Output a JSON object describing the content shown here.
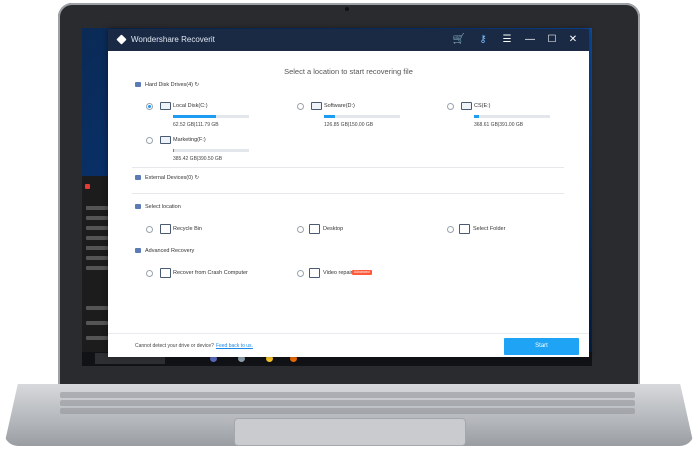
{
  "app": {
    "title": "Wondershare Recoverit",
    "heading": "Select a location to start recovering file",
    "colors": {
      "titlebar": "#1a2a44",
      "accent": "#1ea3f5",
      "cart": "#ff7a3d",
      "tag": "#ff5b3b"
    }
  },
  "titlebar": {
    "icons": [
      "cart-icon",
      "key-icon",
      "menu-icon",
      "minimize-icon",
      "maximize-icon",
      "close-icon"
    ],
    "menu_glyph": "☰",
    "min_glyph": "—",
    "max_glyph": "☐",
    "close_glyph": "✕",
    "cart_glyph": "🛒",
    "key_glyph": "⚷"
  },
  "hard_disk": {
    "label": "Hard Disk Drives(4)",
    "refresh_glyph": "↻",
    "drives": [
      {
        "name": "Local Disk(C:)",
        "size": "62.52  GB|111.79  GB",
        "usage": 0.56,
        "selected": true
      },
      {
        "name": "Software(D:)",
        "size": "126.85  GB|150.00  GB",
        "usage": 0.15,
        "selected": false
      },
      {
        "name": "CS(E:)",
        "size": "368.61  GB|391.00  GB",
        "usage": 0.06,
        "selected": false
      },
      {
        "name": "Marketing(F:)",
        "size": "385.42  GB|390.50  GB",
        "usage": 0.01,
        "selected": false
      }
    ]
  },
  "external": {
    "label": "External Devices(0)",
    "refresh_glyph": "↻"
  },
  "select_location": {
    "label": "Select location",
    "items": [
      {
        "label": "Recycle Bin",
        "icon": "recycle-bin-icon"
      },
      {
        "label": "Desktop",
        "icon": "desktop-icon"
      },
      {
        "label": "Select Folder",
        "icon": "folder-icon"
      }
    ]
  },
  "advanced": {
    "label": "Advanced Recovery",
    "items": [
      {
        "label": "Recover from Crash Computer",
        "icon": "crash-computer-icon"
      },
      {
        "label": "Video repair",
        "icon": "video-repair-icon",
        "tag": "Advanced"
      }
    ]
  },
  "footer": {
    "text": "Cannot detect your drive or device?",
    "link": "Feed back to us.",
    "start": "Start"
  }
}
